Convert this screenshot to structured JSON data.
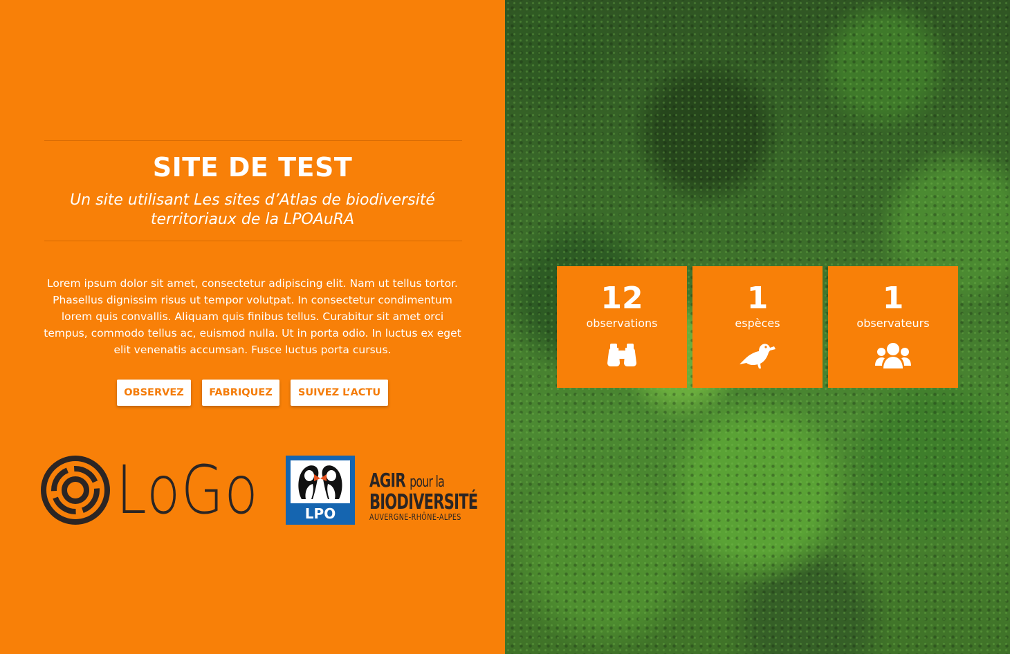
{
  "hero": {
    "title": "SITE DE TEST",
    "subtitle": "Un site utilisant Les sites d’Atlas de biodiversité territoriaux de la LPOAuRA",
    "intro": "Lorem ipsum dolor sit amet, consectetur adipiscing elit. Nam ut tellus tortor. Phasellus dignissim risus ut tempor volutpat. In consectetur condimentum lorem quis convallis. Aliquam quis finibus tellus. Curabitur sit amet orci tempus, commodo tellus ac, euismod nulla. Ut in porta odio. In luctus ex eget elit venenatis accumsan. Fusce luctus porta cursus."
  },
  "buttons": {
    "observe": "OBSERVEZ",
    "build": "FABRIQUEZ",
    "news": "SUIVEZ L’ACTU"
  },
  "logos": {
    "generic": "LoGo",
    "lpo": "LPO",
    "agir_line1_bold": "AGIR",
    "agir_line1_rest": "pour la",
    "agir_line2": "BIODIVERSITÉ",
    "agir_line3": "AUVERGNE-RHÔNE-ALPES"
  },
  "stats": [
    {
      "value": "12",
      "label": "observations",
      "icon": "binoculars-icon"
    },
    {
      "value": "1",
      "label": "espèces",
      "icon": "bird-icon"
    },
    {
      "value": "1",
      "label": "observateurs",
      "icon": "users-icon"
    }
  ],
  "colors": {
    "accent": "#f88008",
    "text_dark": "#2b2524",
    "lpo_blue": "#1565b0"
  }
}
